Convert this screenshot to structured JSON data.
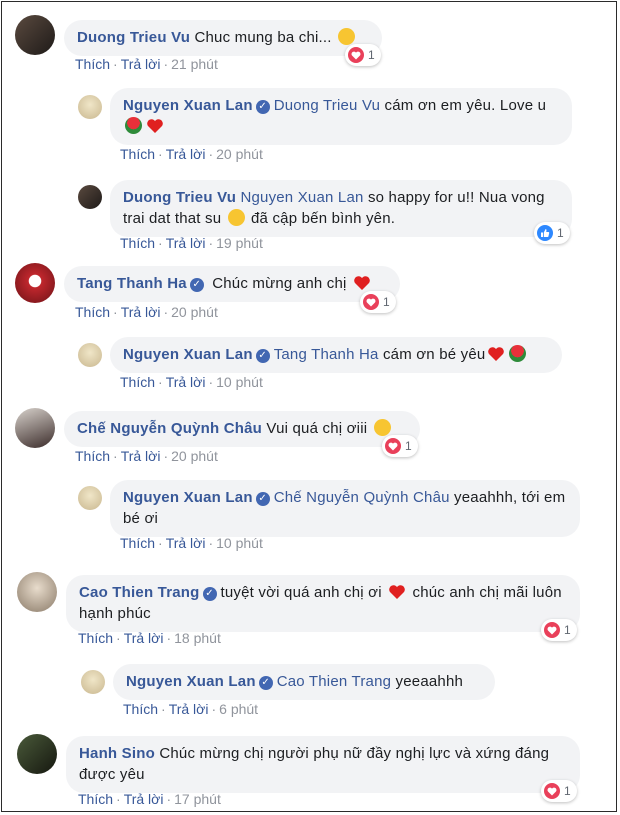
{
  "labels": {
    "like": "Thích",
    "reply": "Trả lời"
  },
  "comments": [
    {
      "author": "Duong Trieu Vu",
      "mention": "",
      "verified": false,
      "text": "Chuc mung ba chi...",
      "time": "21 phút",
      "reaction": {
        "type": "heart",
        "count": "1"
      }
    },
    {
      "author": "Nguyen Xuan Lan",
      "mention": "Duong Trieu Vu",
      "verified": true,
      "text": "cám ơn em yêu. Love u",
      "time": "20 phút",
      "reaction": null
    },
    {
      "author": "Duong Trieu Vu",
      "mention": "Nguyen Xuan Lan",
      "verified": false,
      "text": "so happy for u!! Nua vong trai dat that su",
      "text2": "đã cập bến bình yên.",
      "time": "19 phút",
      "reaction": {
        "type": "like",
        "count": "1"
      }
    },
    {
      "author": "Tang Thanh Ha",
      "mention": "",
      "verified": true,
      "text": "Chúc mừng anh chị",
      "time": "20 phút",
      "reaction": {
        "type": "heart",
        "count": "1"
      }
    },
    {
      "author": "Nguyen Xuan Lan",
      "mention": "Tang Thanh Ha",
      "verified": true,
      "text": "cám ơn bé yêu",
      "time": "10 phút",
      "reaction": null
    },
    {
      "author": "Chế Nguyễn Quỳnh Châu",
      "mention": "",
      "verified": false,
      "text": "Vui quá chị ơiii",
      "time": "20 phút",
      "reaction": {
        "type": "heart",
        "count": "1"
      }
    },
    {
      "author": "Nguyen Xuan Lan",
      "mention": "Chế Nguyễn Quỳnh Châu",
      "verified": true,
      "text": "yeaahhh, tới em bé ơi",
      "time": "10 phút",
      "reaction": null
    },
    {
      "author": "Cao Thien Trang",
      "mention": "",
      "verified": true,
      "text": "tuyệt vời quá anh chị ơi",
      "text2": "chúc anh chị mãi luôn hạnh phúc",
      "time": "18 phút",
      "reaction": {
        "type": "heart",
        "count": "1"
      }
    },
    {
      "author": "Nguyen Xuan Lan",
      "mention": "Cao Thien Trang",
      "verified": true,
      "text": "yeeaahhh",
      "time": "6 phút",
      "reaction": null
    },
    {
      "author": "Hanh Sino",
      "mention": "",
      "verified": false,
      "text": "Chúc mừng chị người phụ nữ đầy nghị lực và xứng đáng được yêu",
      "time": "17 phút",
      "reaction": {
        "type": "heart",
        "count": "1"
      }
    }
  ],
  "colors": {
    "name": "#385898",
    "time": "#90949c",
    "bubble": "#f2f3f5",
    "heart": "#e9405a",
    "like": "#2d88ff",
    "verified": "#4267b2"
  }
}
